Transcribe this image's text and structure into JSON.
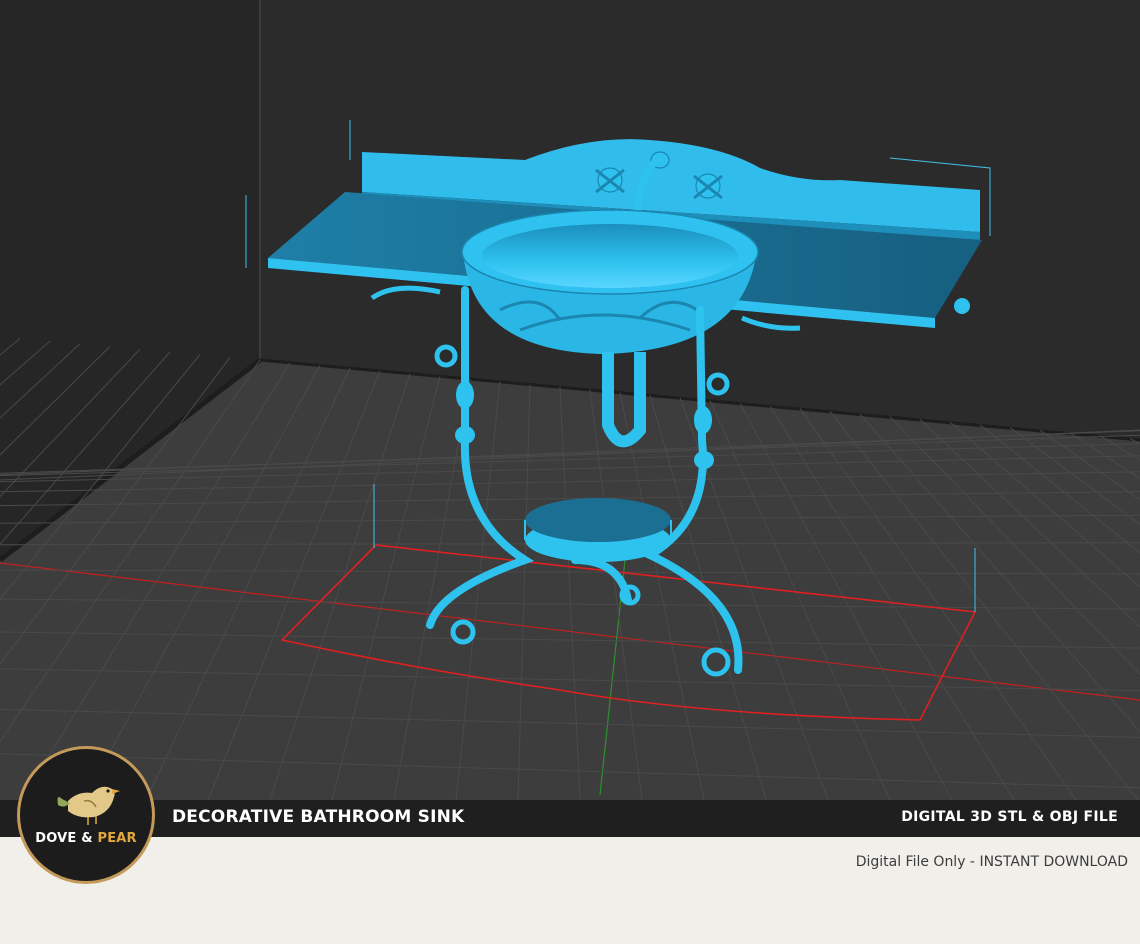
{
  "product": {
    "title": "DECORATIVE BATHROOM SINK",
    "file_format": "DIGITAL 3D STL & OBJ FILE",
    "tagline": "Digital File Only - INSTANT DOWNLOAD"
  },
  "brand": {
    "word1": "DOVE",
    "ampersand": "&",
    "word2": "PEAR"
  },
  "colors": {
    "viewport_background": "#2a2a2a",
    "grid_floor": "#3d3d3d",
    "model": "#2eb8e6",
    "model_shadow": "#1f7fa3",
    "bounding_box": "#e02020",
    "banner": "#1f1f1f",
    "page": "#f1efe9",
    "logo_ring": "#c49a5a",
    "brand_accent": "#e3a93f"
  },
  "icons": {
    "logo": "bird-icon"
  }
}
